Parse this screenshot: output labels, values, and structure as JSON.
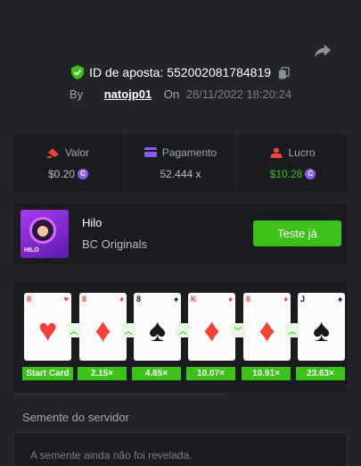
{
  "bet": {
    "id_label": "ID de aposta:",
    "id_value": "552002081784819",
    "by_label": "By",
    "user": "natojp01",
    "on_label": "On",
    "date": "28/11/2022 18:20:24"
  },
  "stats": {
    "valor": {
      "label": "Valor",
      "value": "$0.20",
      "icon": "bet-icon"
    },
    "pagamento": {
      "label": "Pagamento",
      "value": "52.444 x",
      "icon": "card-icon"
    },
    "lucro": {
      "label": "Lucro",
      "value": "$10.28",
      "icon": "profit-icon",
      "color": "#3bc117"
    }
  },
  "game": {
    "name": "Hilo",
    "provider": "BC Originals",
    "thumb_label": "HILO",
    "try_button": "Teste já"
  },
  "cards": [
    {
      "rank": "8",
      "suit": "hearts",
      "symbol": "♥",
      "multiplier": "Start Card"
    },
    {
      "rank": "8",
      "suit": "diamonds",
      "symbol": "♦",
      "multiplier": "2.15×"
    },
    {
      "rank": "8",
      "suit": "spades",
      "symbol": "♠",
      "multiplier": "4.65×"
    },
    {
      "rank": "K",
      "suit": "diamonds",
      "symbol": "♦",
      "multiplier": "10.07×"
    },
    {
      "rank": "8",
      "suit": "diamonds",
      "symbol": "♦",
      "multiplier": "10.91×"
    },
    {
      "rank": "J",
      "suit": "spades",
      "symbol": "♠",
      "multiplier": "23.63×"
    }
  ],
  "arrows": [
    "up",
    "up",
    "up",
    "down",
    "up"
  ],
  "seed": {
    "label": "Semente do servidor",
    "message": "A semente ainda não foi revelada."
  },
  "colors": {
    "accent": "#3bc117",
    "coin": "#8c5af5",
    "card_red": "#f0433c",
    "background": "#232428",
    "panel": "#1b1c1f"
  }
}
